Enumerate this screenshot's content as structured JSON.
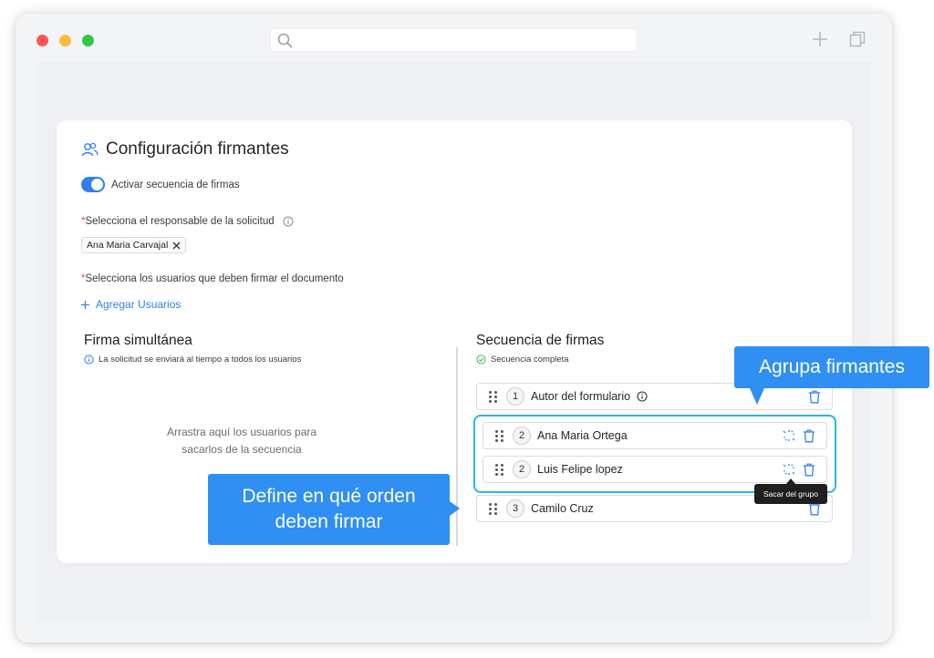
{
  "browser": {
    "search_icon": "search-icon",
    "new_tab_icon": "plus-icon",
    "windows_icon": "copy-icon"
  },
  "page": {
    "title": "Configuración firmantes",
    "title_icon": "users-icon",
    "toggle_label": "Activar secuencia de firmas",
    "toggle_on": true,
    "responsible_label": "Selecciona el responsable de la solicitud",
    "responsible_tag": "Ana Maria Carvajal",
    "users_label": "Selecciona los usuarios que deben firmar el documento",
    "add_users": "Agregar Usuarios",
    "required_mark": "*",
    "accent_color": "#2f80ed"
  },
  "simultaneous": {
    "title": "Firma simultánea",
    "note": "La solicitud se enviará al tiempo a todos los usuarios",
    "drop_hint_line1": "Arrastra aquí los usuarios para",
    "drop_hint_line2": "sacarlos de la secuencia"
  },
  "sequence": {
    "title": "Secuencia de firmas",
    "status": "Secuencia completa",
    "rows": [
      {
        "order": "1",
        "name": "Autor del formulario"
      },
      {
        "order": "2",
        "name": "Ana Maria Ortega"
      },
      {
        "order": "2",
        "name": "Luis Felipe lopez"
      },
      {
        "order": "3",
        "name": "Camilo Cruz"
      }
    ],
    "tooltip": "Sacar del grupo"
  },
  "callouts": {
    "define_line1": "Define en qué orden",
    "define_line2": "deben firmar",
    "agrupa": "Agrupa firmantes",
    "color": "#2f8ff2",
    "group_border_color": "#29b5e8"
  }
}
